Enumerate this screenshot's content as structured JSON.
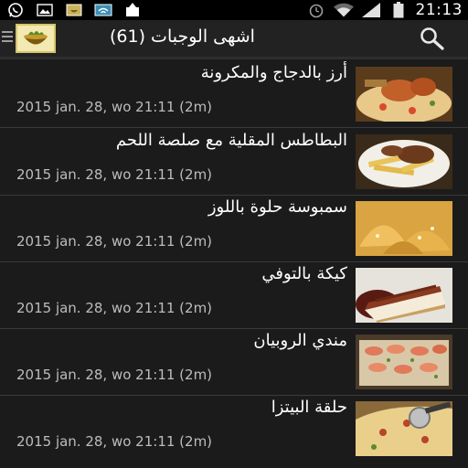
{
  "status_bar": {
    "time": "21:13",
    "icons": [
      "whatsapp-icon",
      "image-icon",
      "app-notification-icon",
      "wifi-hotspot-icon",
      "upload-icon",
      "alarm-icon",
      "wifi-icon",
      "signal-icon",
      "battery-icon"
    ]
  },
  "action_bar": {
    "title": "اشهى الوجبات (61)",
    "search_icon": "search-icon",
    "logo_icon": "food-bowl-icon"
  },
  "colors": {
    "background": "#1b1b1b",
    "status_bar": "#000000",
    "action_bar": "#222222",
    "title_text": "#ffffff",
    "date_text": "#bdbdbd",
    "separator": "#3a3a3a"
  },
  "recipes": [
    {
      "title": "أرز بالدجاج والمكرونة",
      "date": "2015 jan. 28, wo 21:11 (2m)",
      "thumb": "rice-chicken-pasta-image"
    },
    {
      "title": "البطاطس المقلية مع صلصة اللحم",
      "date": "2015 jan. 28, wo 21:11 (2m)",
      "thumb": "fries-meat-sauce-image"
    },
    {
      "title": "سمبوسة حلوة باللوز",
      "date": "2015 jan. 28, wo 21:11 (2m)",
      "thumb": "sambosa-image"
    },
    {
      "title": "كيكة بالتوفي",
      "date": "2015 jan. 28, wo 21:11 (2m)",
      "thumb": "toffee-cake-image"
    },
    {
      "title": "مندي الروبيان",
      "date": "2015 jan. 28, wo 21:11 (2m)",
      "thumb": "shrimp-mandi-image"
    },
    {
      "title": "حلقة البيتزا",
      "date": "2015 jan. 28, wo 21:11 (2m)",
      "thumb": "pizza-ring-image"
    }
  ]
}
